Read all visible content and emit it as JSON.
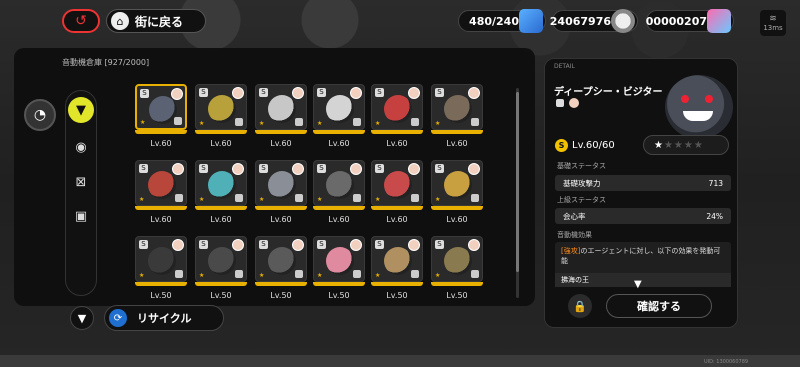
{
  "topbar": {
    "back_icon": "back-arrow-icon",
    "town_label": "街に戻る",
    "stamina": "480/240",
    "dennies": "24067976",
    "polychrome": "00000207",
    "ping": "13ms"
  },
  "inventory": {
    "title": "音動機倉庫",
    "count": "[927/2000]"
  },
  "rail": [
    "bangboo-filter-icon",
    "disc-icon",
    "cross-box-icon",
    "tape-icon"
  ],
  "cards": [
    {
      "lv": "Lv.60",
      "color": "#5a6273",
      "selected": true
    },
    {
      "lv": "Lv.60",
      "color": "#b8a13a"
    },
    {
      "lv": "Lv.60",
      "color": "#c7c7c7"
    },
    {
      "lv": "Lv.60",
      "color": "#d4d4d4"
    },
    {
      "lv": "Lv.60",
      "color": "#c64040"
    },
    {
      "lv": "Lv.60",
      "color": "#7a6a5a"
    },
    {
      "lv": "Lv.60",
      "color": "#b8463a"
    },
    {
      "lv": "Lv.60",
      "color": "#4fb0b8"
    },
    {
      "lv": "Lv.60",
      "color": "#8a8e96"
    },
    {
      "lv": "Lv.60",
      "color": "#6a6a6a"
    },
    {
      "lv": "Lv.60",
      "color": "#c94a4a"
    },
    {
      "lv": "Lv.60",
      "color": "#c9a040"
    },
    {
      "lv": "Lv.50",
      "color": "#3a3a3a"
    },
    {
      "lv": "Lv.50",
      "color": "#4a4a4a"
    },
    {
      "lv": "Lv.50",
      "color": "#5a5a5a"
    },
    {
      "lv": "Lv.50",
      "color": "#e08aa0"
    },
    {
      "lv": "Lv.50",
      "color": "#b09060"
    },
    {
      "lv": "Lv.50",
      "color": "#8a7a50"
    }
  ],
  "actions": {
    "recycle_label": "リサイクル",
    "confirm_label": "確認する"
  },
  "detail": {
    "tag": "DETAIL",
    "name": "ディープシー・ビジター",
    "level": "Lv.60/60",
    "stars_on": "★",
    "stars_off": "★★★★",
    "base_section": "基礎ステータス",
    "base_stat_label": "基礎攻撃力",
    "base_stat_value": "713",
    "adv_section": "上級ステータス",
    "adv_stat_label": "会心率",
    "adv_stat_value": "24%",
    "effect_section": "音動機効果",
    "effect_tag": "[強攻]",
    "effect_text": "のエージェントに対し、以下の効果を発動可能",
    "king": "拂海の王"
  },
  "uid": "UID: 1300060789"
}
